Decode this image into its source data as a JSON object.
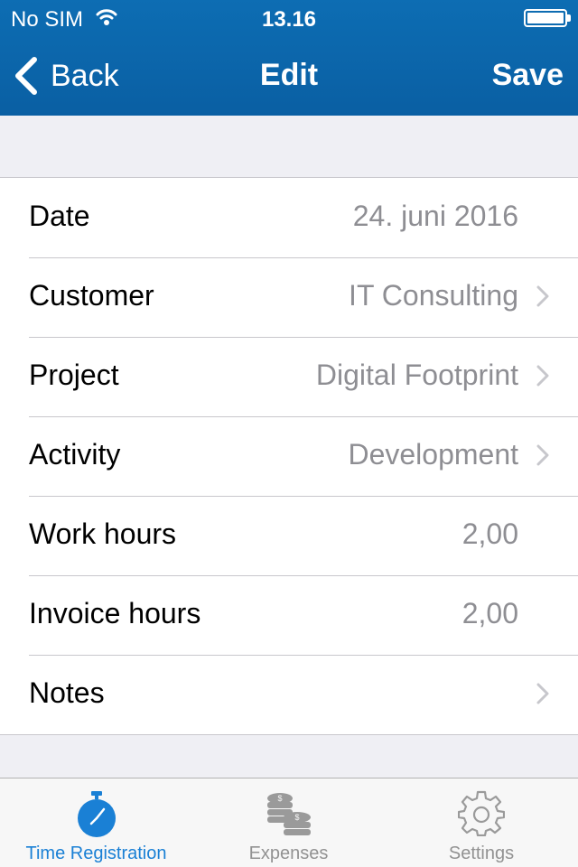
{
  "status_bar": {
    "carrier": "No SIM",
    "time": "13.16"
  },
  "nav": {
    "back_label": "Back",
    "title": "Edit",
    "save_label": "Save"
  },
  "rows": [
    {
      "label": "Date",
      "value": "24. juni 2016",
      "disclosure": false
    },
    {
      "label": "Customer",
      "value": "IT Consulting",
      "disclosure": true
    },
    {
      "label": "Project",
      "value": "Digital Footprint",
      "disclosure": true
    },
    {
      "label": "Activity",
      "value": "Development",
      "disclosure": true
    },
    {
      "label": "Work hours",
      "value": "2,00",
      "disclosure": false
    },
    {
      "label": "Invoice hours",
      "value": "2,00",
      "disclosure": false
    },
    {
      "label": "Notes",
      "value": "",
      "disclosure": true
    }
  ],
  "tabs": [
    {
      "label": "Time Registration",
      "icon": "stopwatch-icon",
      "active": true
    },
    {
      "label": "Expenses",
      "icon": "coins-icon",
      "active": false
    },
    {
      "label": "Settings",
      "icon": "gear-icon",
      "active": false
    }
  ],
  "colors": {
    "nav_bar": "#0d6db3",
    "accent": "#1a80d5",
    "value_text": "#8e8e93",
    "inactive_tab": "#929292"
  }
}
